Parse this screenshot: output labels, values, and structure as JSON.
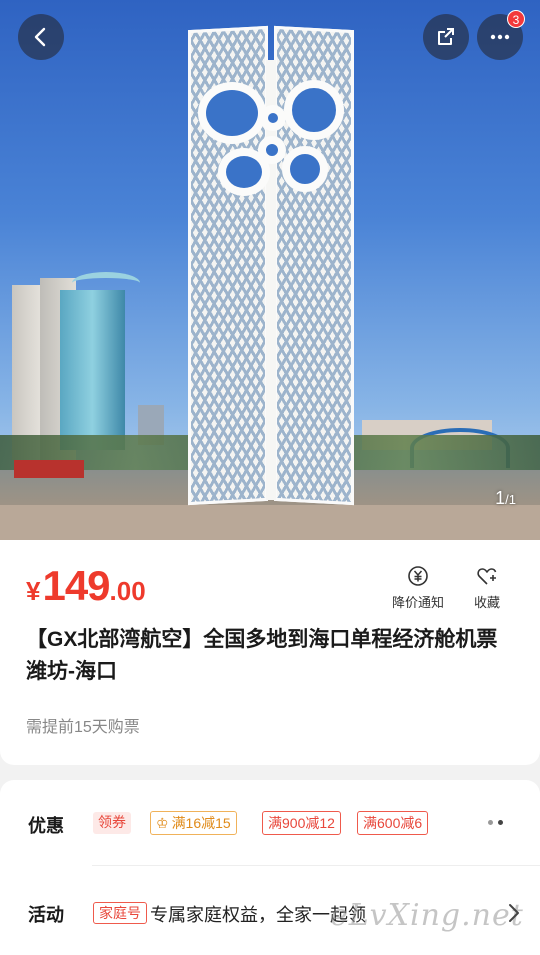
{
  "hero": {
    "pager_current": "1",
    "pager_total": "/1",
    "more_badge": "3"
  },
  "product": {
    "currency": "¥",
    "price_int": "149",
    "price_dec": ".00",
    "title": "【GX北部湾航空】全国多地到海口单程经济舱机票 潍坊-海口",
    "note": "需提前15天购票",
    "notify_label": "降价通知",
    "fav_label": "收藏"
  },
  "promotions": {
    "label": "优惠",
    "coupon_tag": "领券",
    "chips": [
      "满16减15",
      "满900减12",
      "满600减6"
    ]
  },
  "activity": {
    "label": "活动",
    "tag": "家庭号",
    "text": "专属家庭权益，全家一起领"
  },
  "watermark": "eLvXing.net",
  "colors": {
    "accent": "#ee3a2c",
    "gold": "#e08b1a"
  },
  "icons": [
    "back-arrow-icon",
    "share-icon",
    "more-icon",
    "price-drop-icon",
    "heart-plus-icon",
    "crown-icon",
    "chevron-right-icon"
  ]
}
